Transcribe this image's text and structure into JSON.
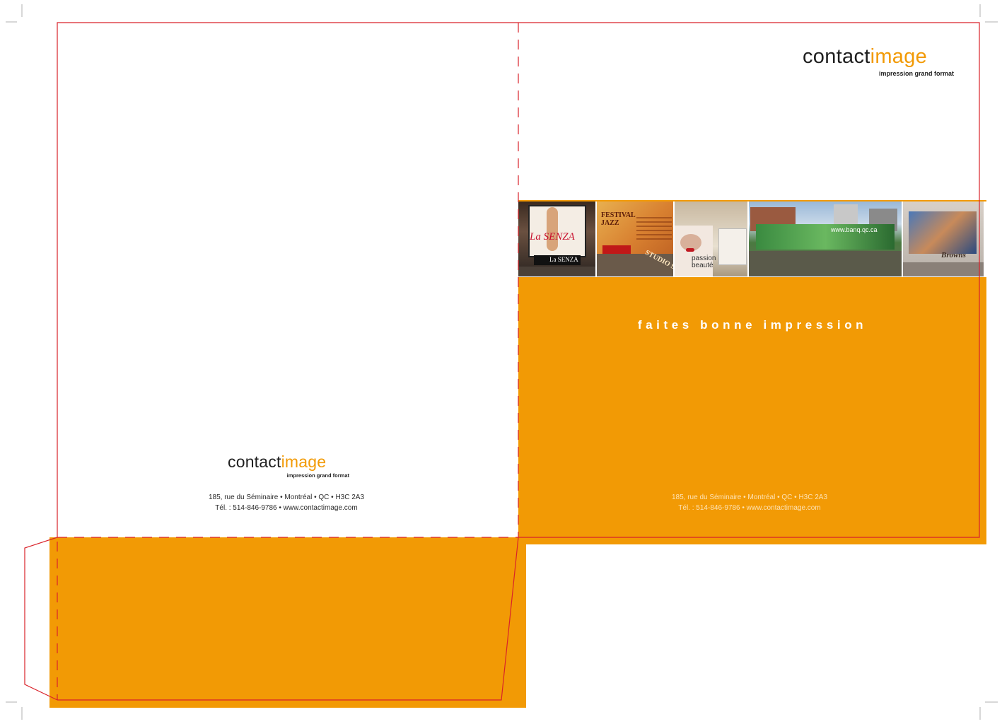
{
  "brand": {
    "name_part1": "contact",
    "name_part2": "image",
    "tagline": "impression grand format"
  },
  "address": {
    "back_line1": "185, rue du Séminaire • Montréal • QC • H3C 2A3",
    "back_line2": "Tél. : 514-846-9786  •  www.contactimage.com",
    "front_line1": "185, rue du Séminaire • Montréal • QC • H3C 2A3",
    "front_line2": "Tél. : 514-846-9786 • www.contactimage.com"
  },
  "slogan": "faites bonne impression",
  "photos": [
    {
      "caption": "La SENZA",
      "sub": "La SENZA"
    },
    {
      "caption": "FESTIVAL JAZZ",
      "sub": "STUDIO SI"
    },
    {
      "caption": "passion beauté"
    },
    {
      "caption": "www.banq.qc.ca"
    },
    {
      "caption": "Browns"
    }
  ],
  "colors": {
    "orange": "#f29a05",
    "dieline": "#d9222a",
    "text_dark": "#1f1f1f"
  }
}
